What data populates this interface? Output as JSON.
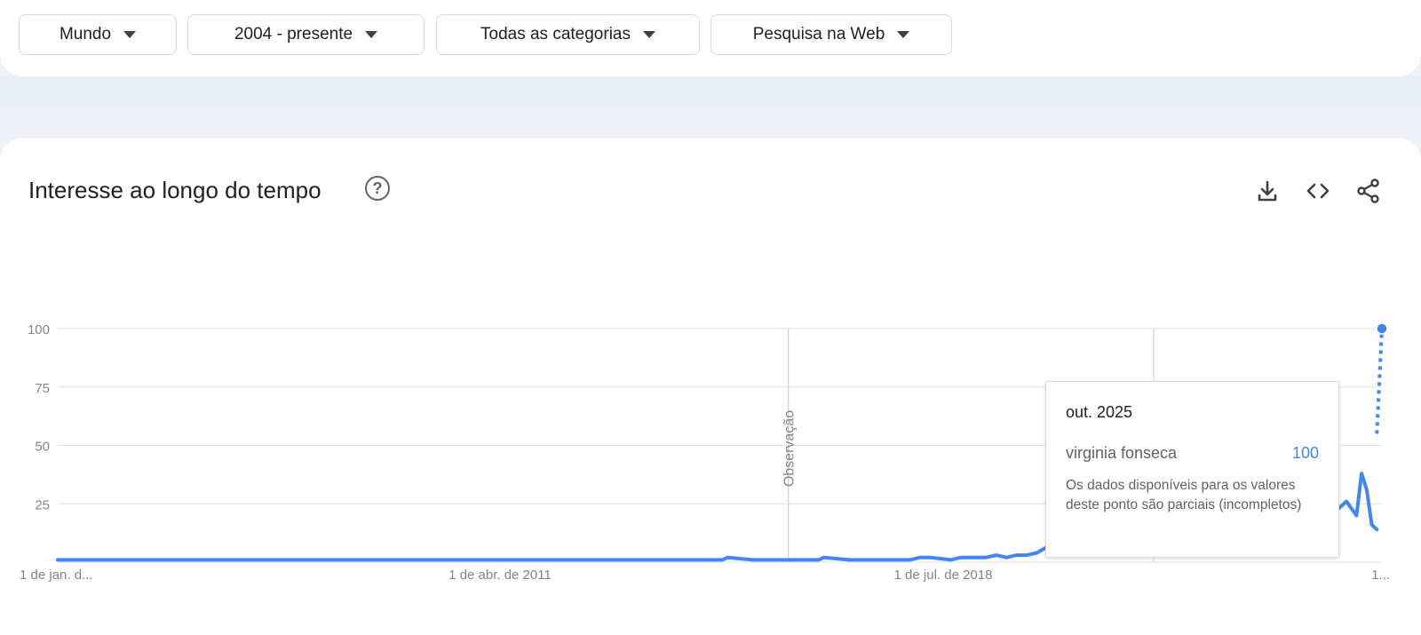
{
  "filters": [
    {
      "label": "Mundo"
    },
    {
      "label": "2004 - presente"
    },
    {
      "label": "Todas as categorias"
    },
    {
      "label": "Pesquisa na Web"
    }
  ],
  "card": {
    "title": "Interesse ao longo do tempo",
    "actions": [
      "download-icon",
      "embed-icon",
      "share-icon"
    ]
  },
  "chart_data": {
    "type": "line",
    "title": "Interesse ao longo do tempo",
    "xlabel": "",
    "ylabel": "",
    "ylim": [
      0,
      100
    ],
    "y_ticks": [
      100,
      75,
      50,
      25
    ],
    "x_tick_labels": [
      "1 de jan. d...",
      "1 de abr. de 2011",
      "1 de jul. de 2018",
      "1..."
    ],
    "annotations": [
      "Observação",
      "Observação"
    ],
    "annotation_dates": [
      "2016-01",
      "2022-01"
    ],
    "grid": true,
    "legend": "none",
    "series": [
      {
        "name": "virginia fonseca",
        "color": "#4285f4",
        "x": [
          "2004-01",
          "2008-06",
          "2012-01",
          "2014-12",
          "2015-01",
          "2015-06",
          "2016-01",
          "2016-07",
          "2016-08",
          "2017-01",
          "2017-07",
          "2018-01",
          "2018-03",
          "2018-05",
          "2018-09",
          "2018-11",
          "2019-01",
          "2019-04",
          "2019-06",
          "2019-08",
          "2019-10",
          "2019-12",
          "2020-02",
          "2020-06",
          "2020-10",
          "2021-02",
          "2021-06",
          "2021-10",
          "2022-02",
          "2022-06",
          "2022-10",
          "2023-01",
          "2023-04",
          "2023-07",
          "2023-10",
          "2024-01",
          "2024-04",
          "2024-06",
          "2024-09",
          "2024-11",
          "2025-01",
          "2025-03",
          "2025-05",
          "2025-06",
          "2025-07",
          "2025-08",
          "2025-09"
        ],
        "values": [
          1,
          1,
          1,
          1,
          2,
          1,
          1,
          1,
          2,
          1,
          1,
          1,
          2,
          2,
          1,
          2,
          2,
          2,
          3,
          2,
          3,
          3,
          4,
          9,
          6,
          5,
          7,
          6,
          9,
          8,
          7,
          5,
          8,
          6,
          10,
          9,
          11,
          14,
          13,
          16,
          22,
          26,
          20,
          38,
          31,
          16,
          14
        ]
      }
    ],
    "partial_segment": {
      "from": {
        "x": "2025-09",
        "y": 55
      },
      "to": {
        "x": "2025-10",
        "y": 100
      }
    },
    "tooltip": {
      "date": "out. 2025",
      "term": "virginia fonseca",
      "value": "100",
      "note": "Os dados disponíveis para os valores deste ponto são parciais (incompletos)"
    }
  }
}
